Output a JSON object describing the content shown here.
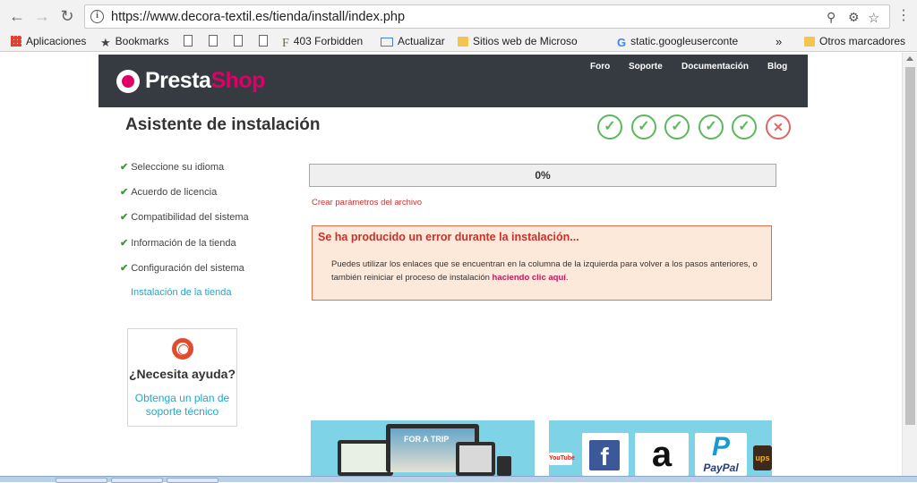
{
  "browser": {
    "url": "https://www.decora-textil.es/tienda/install/index.php",
    "bookmarks": [
      {
        "label": "Aplicaciones",
        "icon": "apps-grid-icon"
      },
      {
        "label": "Bookmarks",
        "icon": "star-icon"
      },
      {
        "label": "",
        "icon": "page-icon"
      },
      {
        "label": "",
        "icon": "page-icon"
      },
      {
        "label": "",
        "icon": "page-icon"
      },
      {
        "label": "",
        "icon": "page-icon"
      },
      {
        "label": "403 Forbidden",
        "icon": "f-favicon-icon"
      },
      {
        "label": "Actualizar",
        "icon": "mail-icon"
      },
      {
        "label": "Sitios web de Microso",
        "icon": "folder-icon"
      },
      {
        "label": "static.googleuserconte",
        "icon": "google-icon"
      },
      {
        "label": "»",
        "icon": "overflow-chevron-icon"
      },
      {
        "label": "Otros marcadores",
        "icon": "folder-icon"
      }
    ]
  },
  "header": {
    "brand_a": "Presta",
    "brand_b": "Shop",
    "nav": [
      "Foro",
      "Soporte",
      "Documentación",
      "Blog"
    ],
    "brand_color": "#df0067",
    "bar_color": "#363a41"
  },
  "page_title": "Asistente de instalación",
  "steps": [
    {
      "label": "Seleccione su idioma",
      "done": true
    },
    {
      "label": "Acuerdo de licencia",
      "done": true
    },
    {
      "label": "Compatibilidad del sistema",
      "done": true
    },
    {
      "label": "Información de la tienda",
      "done": true
    },
    {
      "label": "Configuración del sistema",
      "done": true
    },
    {
      "label": "Instalación de la tienda",
      "done": false
    }
  ],
  "step_indicators": [
    "✓",
    "✓",
    "✓",
    "✓",
    "✓",
    "✕"
  ],
  "help": {
    "title": "¿Necesita ayuda?",
    "link": "Obtenga un plan de soporte técnico"
  },
  "progress": {
    "label": "0%",
    "value": 0
  },
  "progress_status": "Crear parámetros del archivo",
  "error": {
    "title": "Se ha producido un error durante la instalación...",
    "text": "Puedes utilizar los enlaces que se encuentran en la columna de la izquierda para volver a los pasos anteriores, o también reiniciar el proceso de instalación",
    "link": "haciendo clic aquí",
    "tail": "."
  },
  "promo": {
    "laptop_text": "FOR A TRIP",
    "payments": [
      "YouTube",
      "f",
      "a",
      "P",
      "PayPal",
      "ups"
    ]
  }
}
